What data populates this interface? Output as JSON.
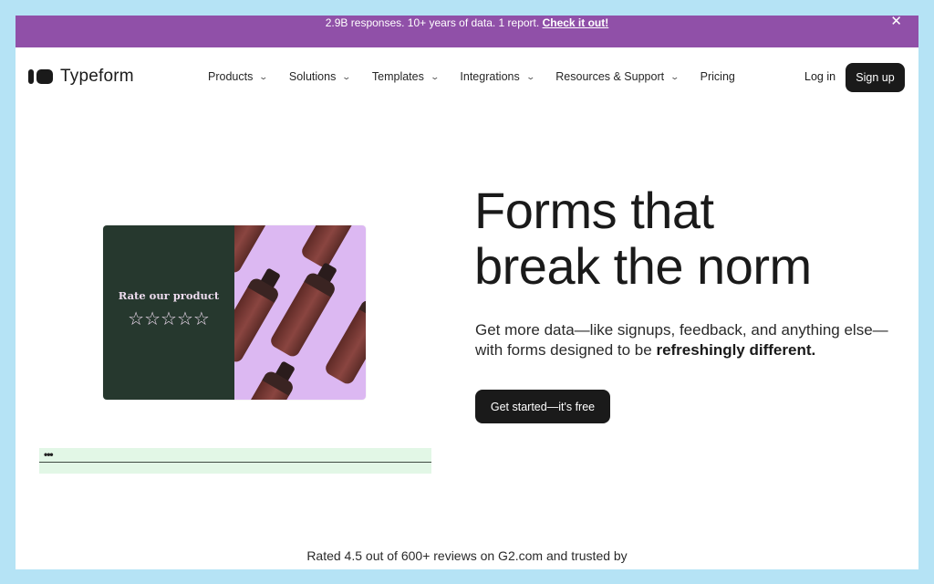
{
  "banner": {
    "message": "2.9B responses. 10+ years of data. 1 report.",
    "link_label": "Check it out!",
    "close_icon": "close-icon",
    "close_glyph": "✕",
    "color": "#9050a8"
  },
  "nav": {
    "brand": "Typeform",
    "items": [
      {
        "label": "Products",
        "has_dropdown": true
      },
      {
        "label": "Solutions",
        "has_dropdown": true
      },
      {
        "label": "Templates",
        "has_dropdown": true
      },
      {
        "label": "Integrations",
        "has_dropdown": true
      },
      {
        "label": "Resources & Support",
        "has_dropdown": true
      },
      {
        "label": "Pricing",
        "has_dropdown": false
      }
    ],
    "chevron_glyph": "⌄",
    "login_label": "Log in",
    "signup_label": "Sign up"
  },
  "preview_card": {
    "question": "Rate our product",
    "stars": "☆☆☆☆☆",
    "star_count": 5,
    "left_color": "#26382e",
    "right_color": "#dcb8f2"
  },
  "input_preview": {
    "typing_indicator": "•••"
  },
  "hero": {
    "title_line1": "Forms that",
    "title_line2": "break the norm",
    "subtitle_plain": "Get more data—like signups, feedback, and anything else—with forms designed to be ",
    "subtitle_bold": "refreshingly different.",
    "cta_label": "Get started—it's free"
  },
  "social_proof": {
    "text": "Rated 4.5 out of 600+ reviews on G2.com and trusted by"
  }
}
